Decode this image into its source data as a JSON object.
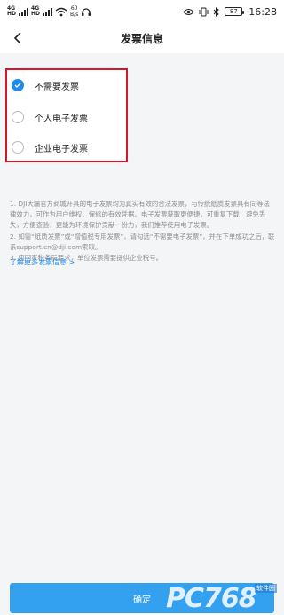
{
  "status_bar": {
    "net_labels": [
      "4G",
      "HD",
      "4G",
      "HD"
    ],
    "speed_value": "60",
    "speed_unit": "B/s",
    "battery": "87",
    "time": "16:28"
  },
  "header": {
    "title": "发票信息",
    "back_icon": "chevron-left-icon"
  },
  "invoice_options": [
    {
      "label": "不需要发票",
      "checked": true
    },
    {
      "label": "个人电子发票",
      "checked": false
    },
    {
      "label": "企业电子发票",
      "checked": false
    }
  ],
  "notes": [
    "1. DJI大疆官方商城开具的电子发票均为真实有效的合法发票，与传统纸质发票具有同等法律效力，可作为用户维权、保修的有效凭据。电子发票获取更便捷，可重复下载，避免丢失，方便查验，更能为环境保护贡献一份力，我们推荐使用电子发票。",
    "2. 如需“纸质发票”或“增值税专用发票”，请勾选“不需要电子发票”，并在下单成功之后，联系support.cn@dji.com索取。",
    "3. 应国家税务局要求，单位发票需要提供企业税号。"
  ],
  "more_link": "了解更多发票信息 >",
  "confirm_label": "确定",
  "watermark": {
    "main": "PC768",
    "sub": "软件园"
  },
  "colors": {
    "accent": "#1f8ceb",
    "button": "#34a0f0",
    "highlight_border": "#d4182b"
  }
}
